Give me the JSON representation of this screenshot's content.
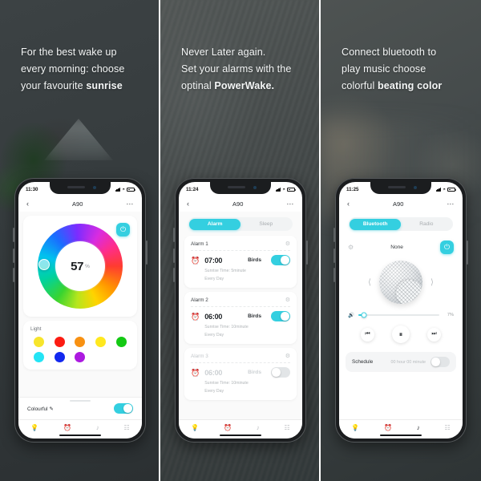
{
  "panels": [
    {
      "headline": {
        "line1": "For the best wake up",
        "line2": "every morning: choose",
        "line3_plain": "your favourite ",
        "line3_bold": "sunrise"
      },
      "phone": {
        "status": {
          "time": "11:30",
          "location_icon": "location-arrow-icon",
          "signal_icon": "signal-bars-icon",
          "wifi_icon": "wifi-icon",
          "battery_icon": "battery-icon"
        },
        "nav": {
          "back_icon": "chevron-left-icon",
          "title": "A90",
          "more_icon": "more-dots-icon"
        },
        "brightness": {
          "value": "57",
          "unit": "%",
          "power_icon": "power-icon"
        },
        "light": {
          "label": "Light",
          "swatches": [
            "#f7e52c",
            "#fc1c12",
            "#f89112",
            "#ffe81f",
            "#13c913",
            "#23e4f5",
            "#1228ef",
            "#ac1ae0"
          ]
        },
        "colourful": {
          "label": "Colourful",
          "edit_icon": "pencil-icon",
          "toggle_on": true
        },
        "tabs": [
          {
            "icon": "lightbulb-icon",
            "glyph": "●",
            "active": true
          },
          {
            "icon": "alarm-clock-icon",
            "glyph": "○",
            "active": false
          },
          {
            "icon": "music-note-icon",
            "glyph": "♪",
            "active": false
          },
          {
            "icon": "grid-apps-icon",
            "glyph": "▦",
            "active": false
          }
        ]
      }
    },
    {
      "headline": {
        "line1": "Never Later again.",
        "line2": "Set your alarms with the",
        "line3_plain": "optinal ",
        "line3_bold": "PowerWake."
      },
      "phone": {
        "status": {
          "time": "11:24",
          "location_icon": "location-arrow-icon",
          "signal_icon": "signal-bars-icon",
          "wifi_icon": "wifi-icon",
          "battery_icon": "battery-icon"
        },
        "nav": {
          "back_icon": "chevron-left-icon",
          "title": "A90",
          "more_icon": "more-dots-icon"
        },
        "segments": [
          {
            "label": "Alarm",
            "active": true
          },
          {
            "label": "Sleep",
            "active": false
          }
        ],
        "alarms": [
          {
            "title": "Alarm 1",
            "gear_icon": "gear-icon",
            "bell_icon": "alarm-bell-icon",
            "time": "07:00",
            "sound": "Birds",
            "sunrise": "Sunrise Time: 5minute",
            "repeat": "Every Day",
            "enabled": true
          },
          {
            "title": "Alarm 2",
            "gear_icon": "gear-icon",
            "bell_icon": "alarm-bell-icon",
            "time": "06:00",
            "sound": "Birds",
            "sunrise": "Sunrise Time: 10minute",
            "repeat": "Every Day",
            "enabled": true
          },
          {
            "title": "Alarm 3",
            "gear_icon": "gear-icon",
            "bell_icon": "alarm-bell-icon",
            "time": "06:00",
            "sound": "Birds",
            "sunrise": "Sunrise Time: 10minute",
            "repeat": "Every Day",
            "enabled": false
          }
        ],
        "tabs": [
          {
            "icon": "lightbulb-icon",
            "glyph": "●",
            "active": false
          },
          {
            "icon": "alarm-clock-icon",
            "glyph": "○",
            "active": true
          },
          {
            "icon": "music-note-icon",
            "glyph": "♪",
            "active": false
          },
          {
            "icon": "grid-apps-icon",
            "glyph": "▦",
            "active": false
          }
        ]
      }
    },
    {
      "headline": {
        "line1": "Connect bluetooth to",
        "line2": "play music choose",
        "line3_plain": "colorful ",
        "line3_bold": "beating color"
      },
      "phone": {
        "status": {
          "time": "11:25",
          "location_icon": "location-arrow-icon",
          "signal_icon": "signal-bars-icon",
          "wifi_icon": "wifi-icon",
          "battery_icon": "battery-icon"
        },
        "nav": {
          "back_icon": "chevron-left-icon",
          "title": "A90",
          "more_icon": "more-dots-icon"
        },
        "segments": [
          {
            "label": "Bluetooth",
            "active": true
          },
          {
            "label": "Radio",
            "active": false
          }
        ],
        "device": {
          "gear_icon": "gear-icon",
          "status_text": "None",
          "power_icon": "power-icon"
        },
        "carousel": {
          "prev_icon": "chevron-left-icon",
          "next_icon": "chevron-right-icon",
          "product_image": "speaker-sphere-image"
        },
        "volume": {
          "icon": "volume-icon",
          "value": "7%",
          "percent": 7
        },
        "transport": {
          "prev_icon": "skip-back-icon",
          "play_pause_icon": "pause-icon",
          "next_icon": "skip-forward-icon"
        },
        "schedule": {
          "label": "Schedule",
          "value": "00 hour 00 minute",
          "toggle_on": false
        },
        "tabs": [
          {
            "icon": "lightbulb-icon",
            "glyph": "●",
            "active": false
          },
          {
            "icon": "alarm-clock-icon",
            "glyph": "○",
            "active": false
          },
          {
            "icon": "music-note-icon",
            "glyph": "♪",
            "active": true
          },
          {
            "icon": "grid-apps-icon",
            "glyph": "▦",
            "active": false
          }
        ]
      }
    }
  ],
  "theme": {
    "accent": "#34cfe0",
    "text_dark": "#1e2226",
    "text_muted": "#b0b4b7",
    "divider": "#ffffff"
  }
}
